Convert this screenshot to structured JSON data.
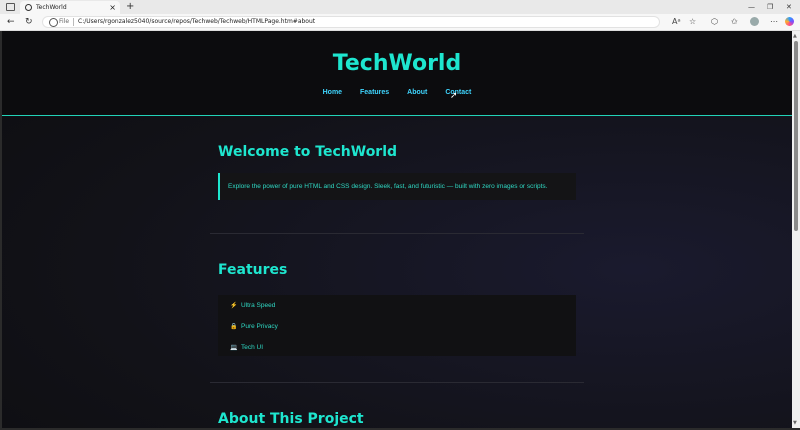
{
  "browser": {
    "tab_title": "TechWorld",
    "tab_close": "×",
    "new_tab": "+",
    "address": {
      "scheme_label": "File",
      "url": "C:/Users/rgonzalez5040/source/repos/Techweb/Techweb/HTMLPage.htm#about"
    },
    "window_controls": {
      "minimize": "—",
      "restore": "❐",
      "close": "✕"
    },
    "nav": {
      "back": "←",
      "refresh": "↻"
    },
    "toolbar_icons": {
      "read_aloud": "Aᵃ",
      "favorite": "☆",
      "extensions": "⬡",
      "favorites_bar": "✩",
      "more": "⋯"
    }
  },
  "page": {
    "site_title": "TechWorld",
    "nav": [
      "Home",
      "Features",
      "About",
      "Contact"
    ],
    "welcome": {
      "title": "Welcome to TechWorld",
      "text": "Explore the power of pure HTML and CSS design. Sleek, fast, and futuristic — built with zero images or scripts."
    },
    "features": {
      "title": "Features",
      "items": [
        {
          "emoji": "⚡",
          "label": "Ultra Speed"
        },
        {
          "emoji": "🔒",
          "label": "Pure Privacy"
        },
        {
          "emoji": "💻",
          "label": "Tech UI"
        }
      ]
    },
    "about": {
      "title": "About This Project"
    }
  },
  "colors": {
    "accent": "#1ee6cf",
    "nav_link": "#3fd6ff",
    "page_bg": "#121218",
    "header_bg": "#0c0c0e"
  }
}
